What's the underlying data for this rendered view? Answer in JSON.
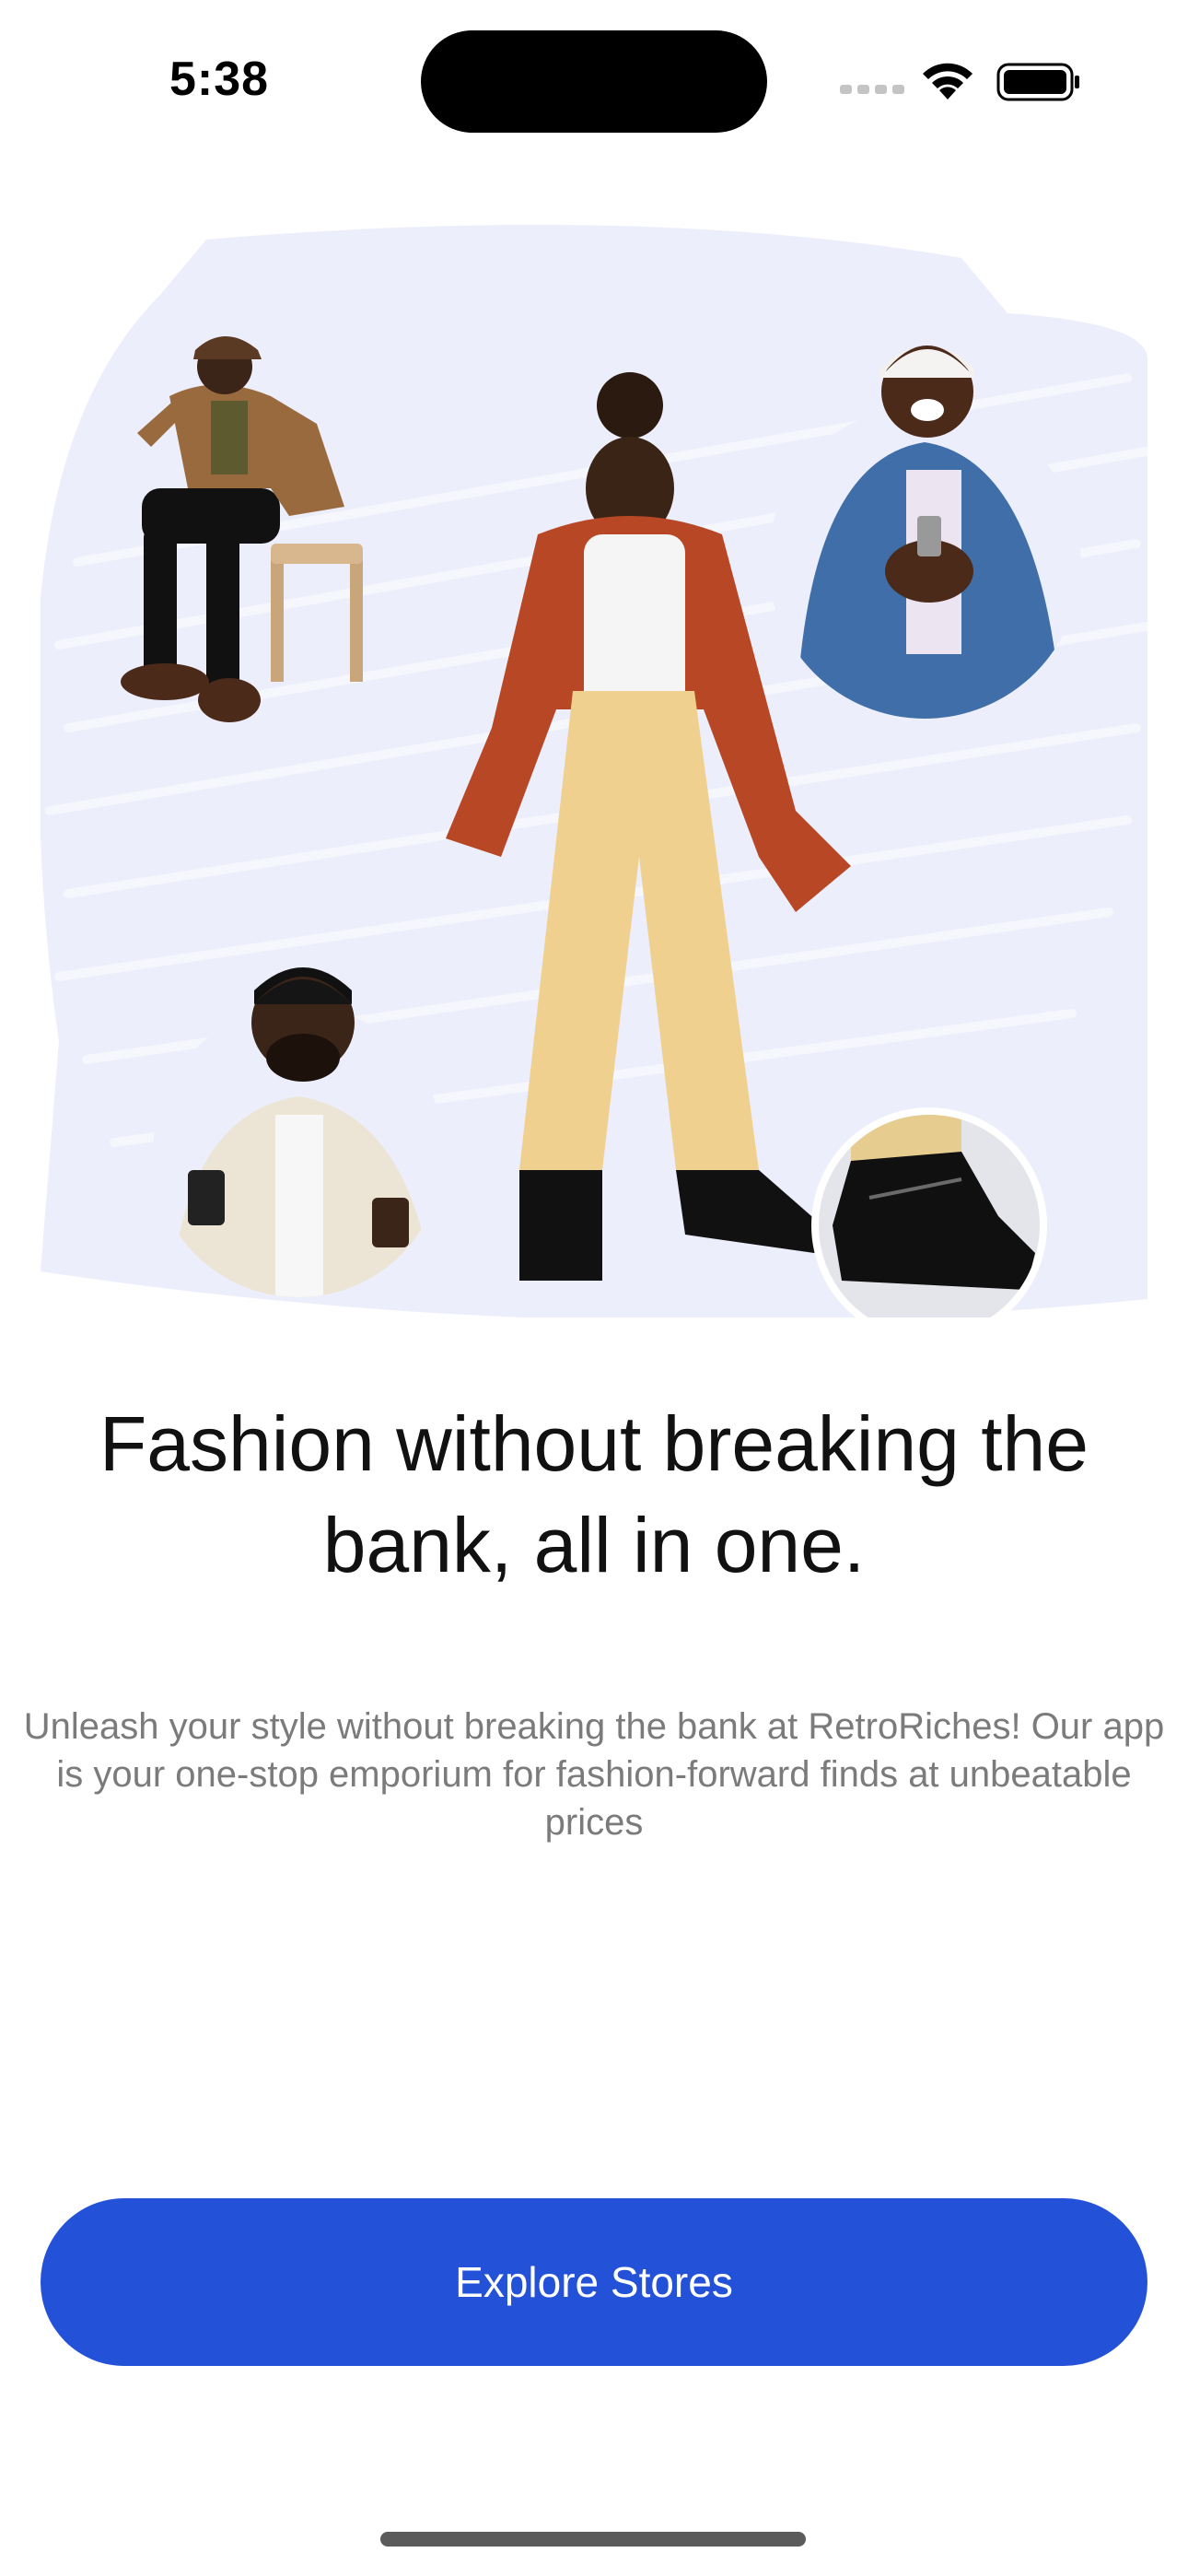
{
  "status_bar": {
    "time": "5:38",
    "icons": [
      "signal-icon",
      "wifi-icon",
      "battery-icon"
    ]
  },
  "hero": {
    "background_color": "#eef0fb",
    "people": [
      "person-sitting-on-stool",
      "person-holding-phone-top-right",
      "woman-in-rust-jacket-center",
      "person-with-phone-and-coffee",
      "black-boot-closeup"
    ]
  },
  "onboarding": {
    "headline": "Fashion without breaking the bank, all in one.",
    "description": "Unleash your style without breaking the bank at RetroRiches! Our app is your one-stop emporium for fashion-forward finds at unbeatable prices"
  },
  "cta": {
    "label": "Explore Stores",
    "color": "#2352d9"
  }
}
